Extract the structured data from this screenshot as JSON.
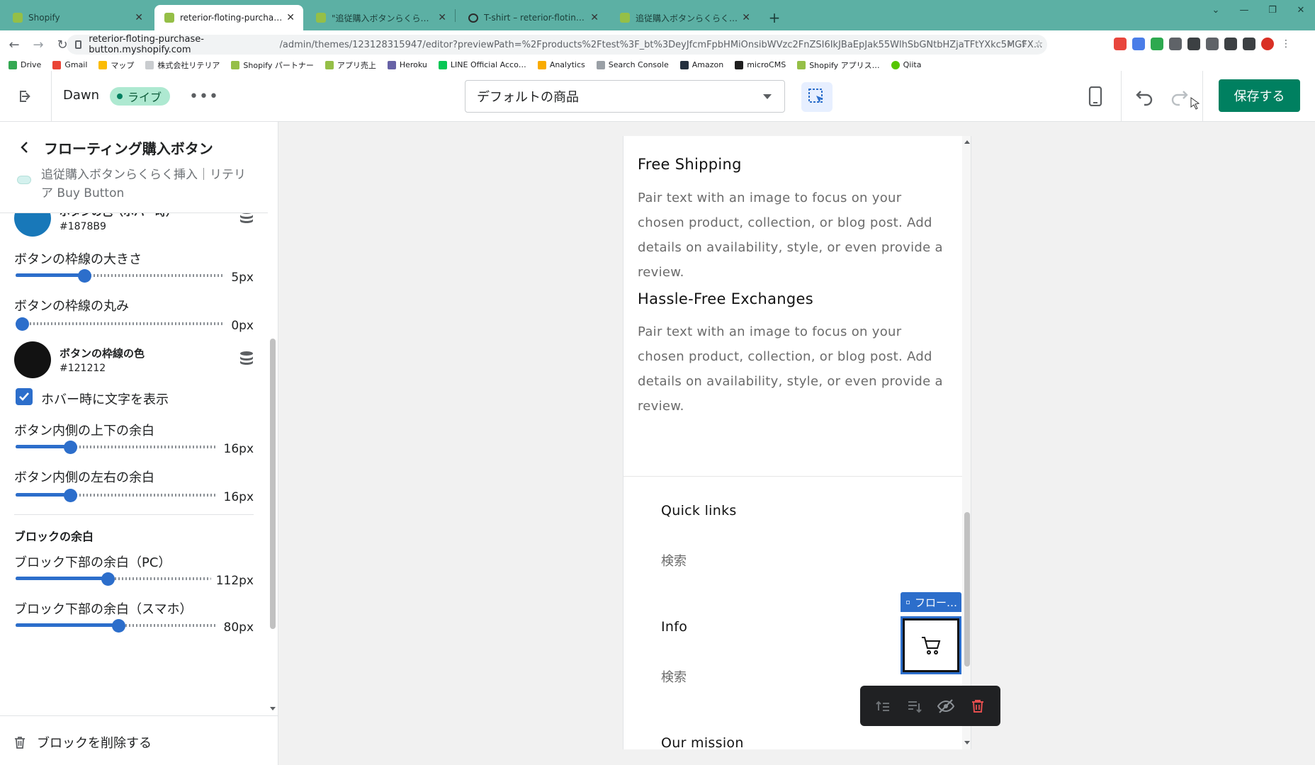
{
  "browser": {
    "tabs": [
      {
        "title": "Shopify",
        "icon": "shopify-icon",
        "active": false
      },
      {
        "title": "reterior-floting-purchase-button",
        "icon": "shopify-icon",
        "active": true
      },
      {
        "title": "\"追従購入ボタンらくらく挿入",
        "icon": "shopify-icon",
        "active": false
      },
      {
        "title": "T-shirt – reterior-floting-purchase",
        "icon": "globe-icon",
        "active": false
      },
      {
        "title": "追従購入ボタンらくらく挿入",
        "icon": "shopify-icon",
        "active": false
      }
    ],
    "url_host": "reterior-floting-purchase-button.myshopify.com",
    "url_path": "/admin/themes/123128315947/editor?previewPath=%2Fproducts%2Ftest%3F_bt%3DeyJfcmFpbHMiOnsibWVzc2FnZSI6IkJBaEpJak55WlhSbGNtbHZjaTFtYXkc5MGFXNW5MWEIxY21Ob1lYTm…",
    "bookmarks": [
      "Drive",
      "Gmail",
      "マップ",
      "株式会社リテリア",
      "Shopify パートナー",
      "アプリ売上",
      "Heroku",
      "LINE Official Acco…",
      "Analytics",
      "Search Console",
      "Amazon",
      "microCMS",
      "Shopify アプリス…",
      "Qiita"
    ],
    "colors": {
      "tabbar": "#5cb0a4"
    }
  },
  "editor": {
    "theme_name": "Dawn",
    "live_label": "ライブ",
    "template_select": "デフォルトの商品",
    "save_label": "保存する"
  },
  "sidebar": {
    "title": "フローティング購入ボタン",
    "app_name": "追従購入ボタンらくらく挿入｜リテリア Buy Button",
    "hover_color": {
      "label": "ボタンの色（ホバー時）",
      "hex": "#1878B9"
    },
    "border_width": {
      "label": "ボタンの枠線の大きさ",
      "value": "5px",
      "fraction": 0.33
    },
    "border_radius": {
      "label": "ボタンの枠線の丸み",
      "value": "0px",
      "fraction": 0.0
    },
    "border_color": {
      "label": "ボタンの枠線の色",
      "hex": "#121212"
    },
    "show_text_on_hover": {
      "label": "ホバー時に文字を表示",
      "checked": true
    },
    "padding_vertical": {
      "label": "ボタン内側の上下の余白",
      "value": "16px",
      "fraction": 0.27
    },
    "padding_horizontal": {
      "label": "ボタン内側の左右の余白",
      "value": "16px",
      "fraction": 0.27
    },
    "block_margin_section": "ブロックの余白",
    "margin_bottom_pc": {
      "label": "ブロック下部の余白（PC）",
      "value": "112px",
      "fraction": 0.47
    },
    "margin_bottom_sp": {
      "label": "ブロック下部の余白（スマホ）",
      "value": "80px",
      "fraction": 0.51
    },
    "delete_label": "ブロックを削除する"
  },
  "preview": {
    "sections": [
      {
        "heading": "Free Shipping",
        "text": "Pair text with an image to focus on your chosen product, collection, or blog post. Add details on availability, style, or even provide a review."
      },
      {
        "heading": "Hassle-Free Exchanges",
        "text": "Pair text with an image to focus on your chosen product, collection, or blog post. Add details on availability, style, or even provide a review."
      }
    ],
    "footer": {
      "quick_links": "Quick links",
      "quick_links_item": "検索",
      "info": "Info",
      "info_item": "検索",
      "our_mission": "Our mission"
    },
    "block_tag": "フロー…",
    "accent": "#2c6ecb"
  }
}
